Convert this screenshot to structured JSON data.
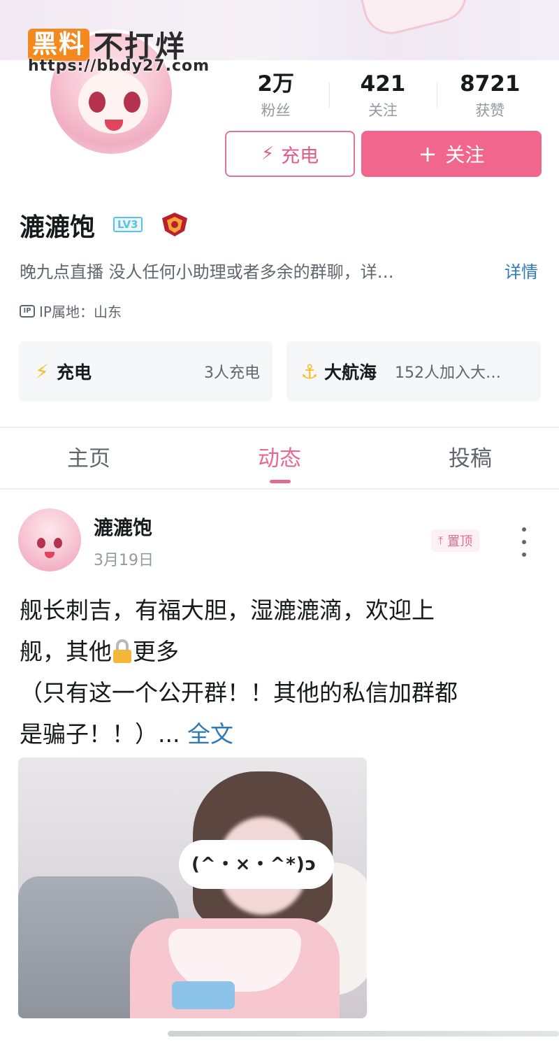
{
  "watermark": {
    "badge": "黑料",
    "title": "不打烊",
    "url": "https://bbdy27.com"
  },
  "profile": {
    "name": "漉漉饱",
    "level": "LV3",
    "bio": "晚九点直播  没人任何小助理或者多余的群聊，详…",
    "bio_more": "详情",
    "ip_location": "IP属地：山东"
  },
  "stats": [
    {
      "value": "2万",
      "label": "粉丝"
    },
    {
      "value": "421",
      "label": "关注"
    },
    {
      "value": "8721",
      "label": "获赞"
    }
  ],
  "buttons": {
    "charge": "充电",
    "follow": "关注"
  },
  "cards": {
    "charge": {
      "title": "充电",
      "meta": "3人充电"
    },
    "voyage": {
      "title": "大航海",
      "meta": "152人加入大…"
    }
  },
  "tabs": [
    {
      "label": "主页",
      "active": false
    },
    {
      "label": "动态",
      "active": true
    },
    {
      "label": "投稿",
      "active": false
    }
  ],
  "post": {
    "author": "漉漉饱",
    "date": "3月19日",
    "pinned_label": "置顶",
    "text_line1": "舰长刺吉，有福大胆，湿漉漉滴，欢迎上",
    "text_line2_a": "舰，其他",
    "text_line2_b": "更多",
    "text_line3": "（只有这一个公开群！！其他的私信加群都",
    "text_line4": "是骗子！！）... ",
    "more_link": "全文",
    "image_caption": "(^・×・^*)ↄ"
  },
  "colors": {
    "accent": "#f1668d",
    "link": "#2e7ab8",
    "watermark_badge": "#f48a1f"
  }
}
